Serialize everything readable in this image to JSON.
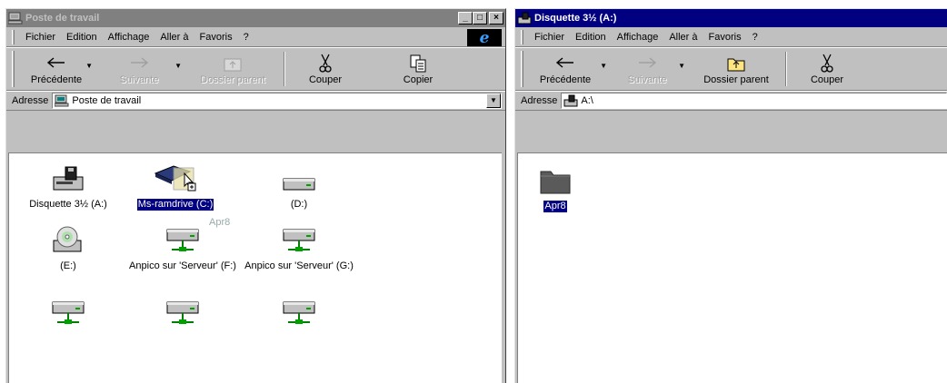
{
  "left_window": {
    "title": "Poste de travail",
    "controls": [
      "_",
      "□",
      "×"
    ],
    "menu": [
      "Fichier",
      "Edition",
      "Affichage",
      "Aller à",
      "Favoris",
      "?"
    ],
    "menu_mnemonics": [
      "F",
      "E",
      "h",
      "A",
      "v",
      "?"
    ],
    "toolbar": {
      "back": "Précédente",
      "forward": "Suivante",
      "up": "Dossier parent",
      "cut": "Couper",
      "copy": "Copier"
    },
    "address_label": "Adresse",
    "address_value": "Poste de travail",
    "items": [
      {
        "label": "Disquette 3½ (A:)",
        "icon": "floppy-drive-icon"
      },
      {
        "label": "Ms-ramdrive (C:)",
        "icon": "ram-drive-icon",
        "selected": true
      },
      {
        "label": "(D:)",
        "icon": "hard-drive-icon"
      },
      {
        "label": "(E:)",
        "icon": "cd-drive-icon"
      },
      {
        "label": "Anpico sur 'Serveur' (F:)",
        "icon": "network-drive-icon"
      },
      {
        "label": "Anpico sur 'Serveur' (G:)",
        "icon": "network-drive-icon"
      },
      {
        "label": "",
        "icon": "network-drive-icon"
      },
      {
        "label": "",
        "icon": "network-drive-icon"
      },
      {
        "label": "",
        "icon": "network-drive-icon"
      }
    ],
    "drag_ghost_label": "Apr8"
  },
  "right_window": {
    "title": "Disquette 3½ (A:)",
    "menu": [
      "Fichier",
      "Edition",
      "Affichage",
      "Aller à",
      "Favoris",
      "?"
    ],
    "toolbar": {
      "back": "Précédente",
      "forward": "Suivante",
      "up": "Dossier parent",
      "cut": "Couper"
    },
    "address_label": "Adresse",
    "address_value": "A:\\",
    "items": [
      {
        "label": "Apr8",
        "icon": "folder-icon",
        "selected": true
      }
    ]
  },
  "colors": {
    "titlebar_active": "#000080",
    "titlebar_inactive": "#808080",
    "face": "#c0c0c0",
    "selection": "#000080"
  }
}
